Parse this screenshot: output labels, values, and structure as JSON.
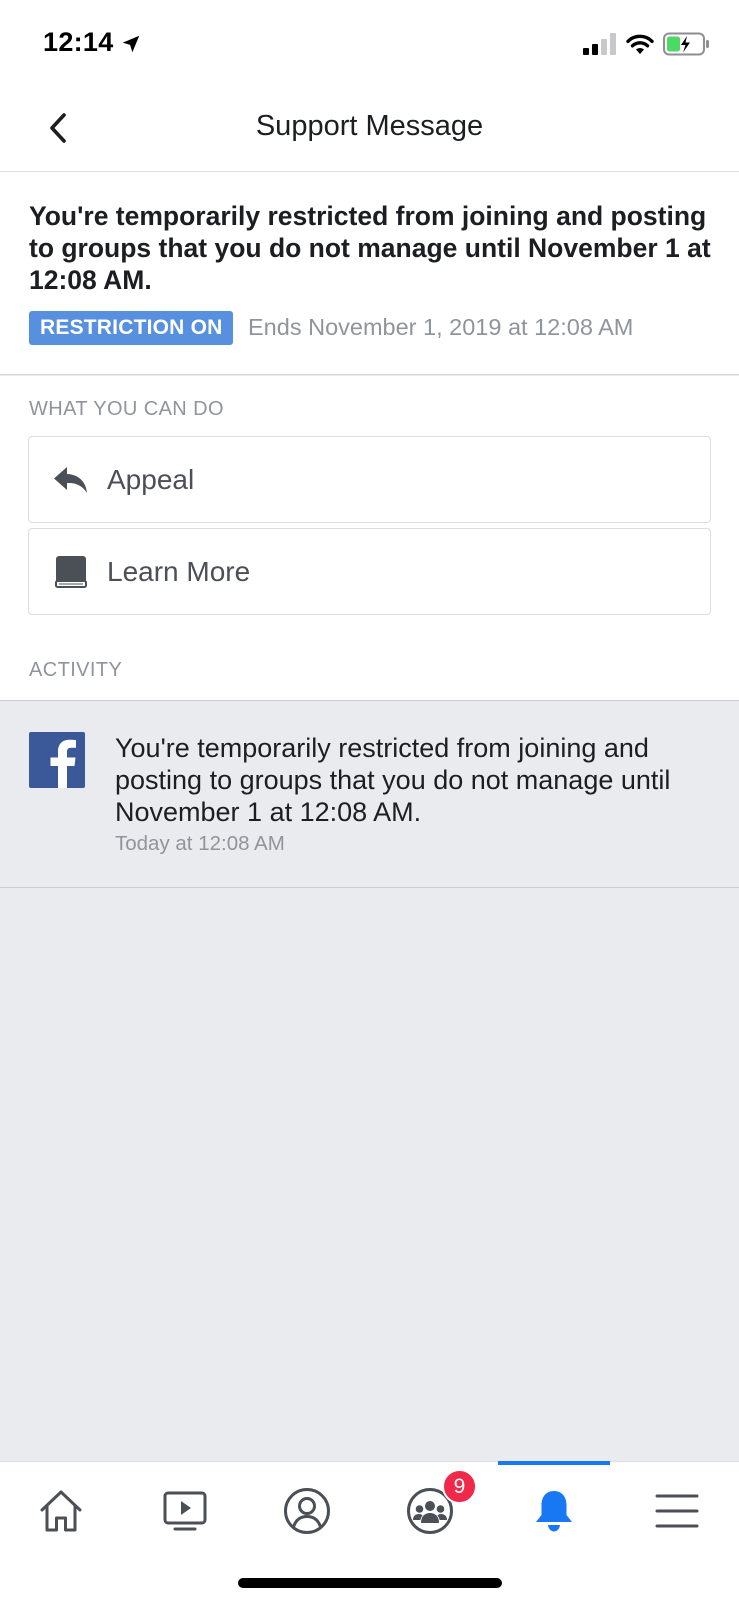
{
  "status_bar": {
    "time": "12:14"
  },
  "header": {
    "title": "Support Message"
  },
  "restriction": {
    "title": "You're temporarily restricted from joining and posting to groups that you do not manage until November 1 at 12:08 AM.",
    "badge": "RESTRICTION ON",
    "ends": "Ends November 1, 2019 at 12:08 AM"
  },
  "actions": {
    "section_label": "WHAT YOU CAN DO",
    "items": [
      {
        "label": "Appeal",
        "icon": "reply-icon"
      },
      {
        "label": "Learn More",
        "icon": "book-icon"
      }
    ]
  },
  "activity": {
    "section_label": "ACTIVITY",
    "message": "You're temporarily restricted from joining and posting to groups that you do not manage until November 1 at 12:08 AM.",
    "time": "Today at 12:08 AM"
  },
  "tabbar": {
    "tabs": [
      {
        "name": "home",
        "icon": "home-icon"
      },
      {
        "name": "watch",
        "icon": "video-icon"
      },
      {
        "name": "profile",
        "icon": "profile-icon"
      },
      {
        "name": "groups",
        "icon": "groups-icon"
      },
      {
        "name": "notifications",
        "icon": "bell-icon",
        "active": true
      },
      {
        "name": "menu",
        "icon": "menu-icon"
      }
    ],
    "groups_badge": "9",
    "active_color": "#1877f2",
    "badge_color": "#f02849"
  },
  "colors": {
    "badge_blue": "#5890e0",
    "facebook_blue": "#3b5998",
    "secondary_text": "#90949c"
  }
}
